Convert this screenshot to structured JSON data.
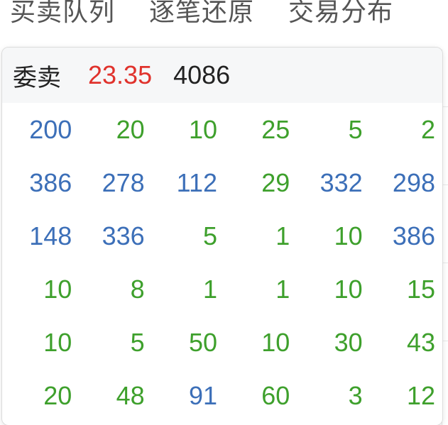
{
  "tabs": [
    {
      "label": "买卖队列"
    },
    {
      "label": "逐笔还原"
    },
    {
      "label": "交易分布"
    }
  ],
  "popover": {
    "label": "委卖",
    "price": "23.35",
    "volume": "4086"
  },
  "colors": {
    "blue": "#3c6fb8",
    "green": "#3ea02c",
    "red": "#e0322c"
  },
  "rows": [
    [
      {
        "v": "200",
        "c": "blue"
      },
      {
        "v": "20",
        "c": "green"
      },
      {
        "v": "10",
        "c": "green"
      },
      {
        "v": "25",
        "c": "green"
      },
      {
        "v": "5",
        "c": "green"
      },
      {
        "v": "2",
        "c": "green"
      }
    ],
    [
      {
        "v": "386",
        "c": "blue"
      },
      {
        "v": "278",
        "c": "blue"
      },
      {
        "v": "112",
        "c": "blue"
      },
      {
        "v": "29",
        "c": "green"
      },
      {
        "v": "332",
        "c": "blue"
      },
      {
        "v": "298",
        "c": "blue"
      }
    ],
    [
      {
        "v": "148",
        "c": "blue"
      },
      {
        "v": "336",
        "c": "blue"
      },
      {
        "v": "5",
        "c": "green"
      },
      {
        "v": "1",
        "c": "green"
      },
      {
        "v": "10",
        "c": "green"
      },
      {
        "v": "386",
        "c": "blue"
      }
    ],
    [
      {
        "v": "10",
        "c": "green"
      },
      {
        "v": "8",
        "c": "green"
      },
      {
        "v": "1",
        "c": "green"
      },
      {
        "v": "1",
        "c": "green"
      },
      {
        "v": "10",
        "c": "green"
      },
      {
        "v": "15",
        "c": "green"
      }
    ],
    [
      {
        "v": "10",
        "c": "green"
      },
      {
        "v": "5",
        "c": "green"
      },
      {
        "v": "50",
        "c": "green"
      },
      {
        "v": "10",
        "c": "green"
      },
      {
        "v": "30",
        "c": "green"
      },
      {
        "v": "43",
        "c": "green"
      }
    ],
    [
      {
        "v": "20",
        "c": "green"
      },
      {
        "v": "48",
        "c": "green"
      },
      {
        "v": "91",
        "c": "blue"
      },
      {
        "v": "60",
        "c": "green"
      },
      {
        "v": "3",
        "c": "green"
      },
      {
        "v": "12",
        "c": "green"
      }
    ]
  ]
}
